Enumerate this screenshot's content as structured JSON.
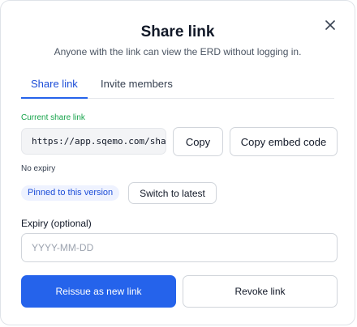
{
  "modal": {
    "title": "Share link",
    "subtitle": "Anyone with the link can view the ERD without logging in."
  },
  "tabs": [
    {
      "label": "Share link",
      "active": true
    },
    {
      "label": "Invite members",
      "active": false
    }
  ],
  "share": {
    "current_label": "Current share link",
    "url": "https://app.sqemo.com/share",
    "copy_label": "Copy",
    "embed_label": "Copy embed code",
    "expiry_status": "No expiry",
    "pinned_badge": "Pinned to this version",
    "switch_label": "Switch to latest"
  },
  "expiry": {
    "label": "Expiry (optional)",
    "placeholder": "YYYY-MM-DD",
    "value": ""
  },
  "actions": {
    "reissue_label": "Reissue as new link",
    "revoke_label": "Revoke link"
  },
  "icons": {
    "close": "close-icon"
  },
  "colors": {
    "primary": "#2563eb",
    "current_label": "#16a34a",
    "badge_bg": "#eef2ff",
    "badge_text": "#1d4ed8"
  }
}
